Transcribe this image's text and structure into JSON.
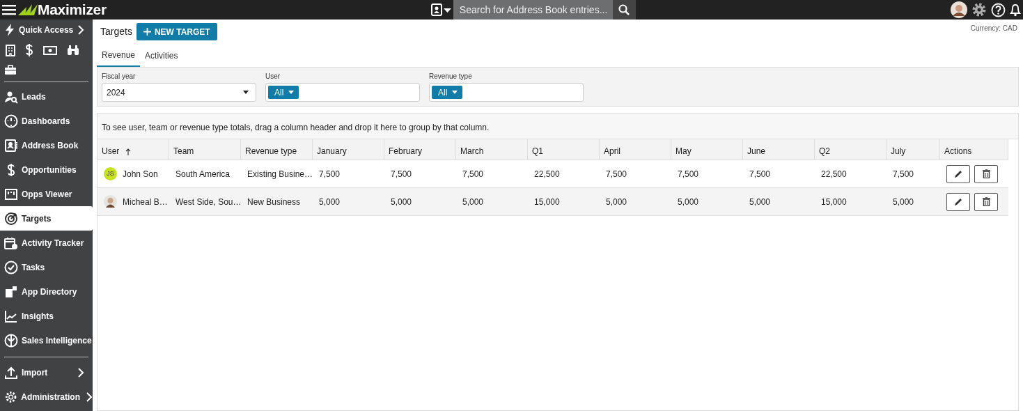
{
  "app": {
    "name": "Maximizer",
    "search": {
      "placeholder": "Search for Address Book entries..."
    }
  },
  "sidebar": {
    "quick_access": {
      "label": "Quick Access"
    },
    "items": [
      {
        "label": "Leads",
        "selected": false
      },
      {
        "label": "Dashboards",
        "selected": false
      },
      {
        "label": "Address Book",
        "selected": false
      },
      {
        "label": "Opportunities",
        "selected": false
      },
      {
        "label": "Opps Viewer",
        "selected": false
      },
      {
        "label": "Targets",
        "selected": true
      },
      {
        "label": "Activity Tracker",
        "selected": false
      },
      {
        "label": "Tasks",
        "selected": false
      },
      {
        "label": "App Directory",
        "selected": false
      },
      {
        "label": "Insights",
        "selected": false
      },
      {
        "label": "Sales Intelligence",
        "selected": false
      }
    ],
    "footer_items": [
      {
        "label": "Import"
      },
      {
        "label": "Administration"
      }
    ]
  },
  "page": {
    "title": "Targets",
    "new_button": "NEW TARGET",
    "currency": "Currency: CAD",
    "tabs": [
      {
        "label": "Revenue",
        "selected": true
      },
      {
        "label": "Activities",
        "selected": false
      }
    ],
    "filters": [
      {
        "kind": "select",
        "label": "Fiscal year",
        "value": "2024"
      },
      {
        "kind": "chip",
        "label": "User",
        "value": "All"
      },
      {
        "kind": "chip",
        "label": "Revenue type",
        "value": "All"
      }
    ],
    "group_hint": "To see user, team or revenue type totals, drag a column header and drop it here to group by that column.",
    "table": {
      "columns": [
        {
          "label": "User",
          "sorted": true
        },
        {
          "label": "Team"
        },
        {
          "label": "Revenue type"
        },
        {
          "label": "January"
        },
        {
          "label": "February"
        },
        {
          "label": "March"
        },
        {
          "label": "Q1"
        },
        {
          "label": "April"
        },
        {
          "label": "May"
        },
        {
          "label": "June"
        },
        {
          "label": "Q2"
        },
        {
          "label": "July"
        },
        {
          "label": "Actions"
        }
      ],
      "rows": [
        {
          "avatar": {
            "kind": "initials",
            "initials": "JS",
            "color": "#c8e11e"
          },
          "cells": [
            "John Son",
            "South America",
            "Existing Busine…",
            "7,500",
            "7,500",
            "7,500",
            "22,500",
            "7,500",
            "7,500",
            "7,500",
            "22,500",
            "7,500"
          ]
        },
        {
          "avatar": {
            "kind": "photo"
          },
          "cells": [
            "Micheal B…",
            "West Side, Sou…",
            "New Business",
            "5,000",
            "5,000",
            "5,000",
            "15,000",
            "5,000",
            "5,000",
            "5,000",
            "15,000",
            "5,000"
          ]
        }
      ]
    }
  }
}
